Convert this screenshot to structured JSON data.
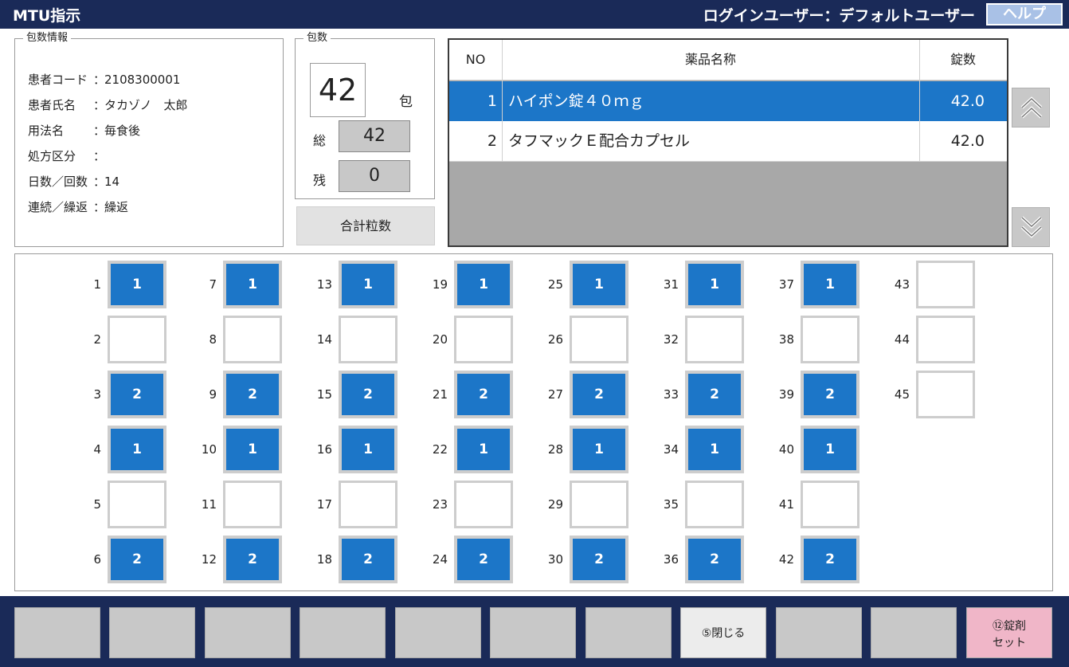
{
  "titlebar": {
    "title": "MTU指示",
    "login_user": "ログインユーザー：デフォルトユーザー",
    "help_label": "ヘルプ"
  },
  "package_info": {
    "legend": "包数情報",
    "rows": [
      {
        "label": "患者コード",
        "sep": "：",
        "value": "2108300001"
      },
      {
        "label": "患者氏名",
        "sep": "：",
        "value": "タカゾノ　太郎"
      },
      {
        "label": "用法名",
        "sep": "：",
        "value": "毎食後"
      },
      {
        "label": "処方区分",
        "sep": "：",
        "value": ""
      },
      {
        "label": "日数／回数",
        "sep": "：",
        "value": "14"
      },
      {
        "label": "連続／繰返",
        "sep": "：",
        "value": "繰返"
      }
    ]
  },
  "package_count": {
    "legend": "包数",
    "value": "42",
    "unit": "包",
    "total_label": "総",
    "total_value": "42",
    "remaining_label": "残",
    "remaining_value": "0"
  },
  "total_pills_button": "合計粒数",
  "drug_table": {
    "headers": {
      "no": "NO",
      "name": "薬品名称",
      "count": "錠数"
    },
    "rows": [
      {
        "no": "1",
        "name": "ハイポン錠４０ｍｇ",
        "count": "42.0",
        "selected": true
      },
      {
        "no": "2",
        "name": "タフマックＥ配合カプセル",
        "count": "42.0",
        "selected": false
      }
    ]
  },
  "scroll": {
    "up_icon": "double-chevron-up-icon",
    "down_icon": "double-chevron-down-icon"
  },
  "grid": {
    "cells": [
      {
        "n": "1",
        "v": "1"
      },
      {
        "n": "2",
        "v": ""
      },
      {
        "n": "3",
        "v": "2"
      },
      {
        "n": "4",
        "v": "1"
      },
      {
        "n": "5",
        "v": ""
      },
      {
        "n": "6",
        "v": "2"
      },
      {
        "n": "7",
        "v": "1"
      },
      {
        "n": "8",
        "v": ""
      },
      {
        "n": "9",
        "v": "2"
      },
      {
        "n": "10",
        "v": "1"
      },
      {
        "n": "11",
        "v": ""
      },
      {
        "n": "12",
        "v": "2"
      },
      {
        "n": "13",
        "v": "1"
      },
      {
        "n": "14",
        "v": ""
      },
      {
        "n": "15",
        "v": "2"
      },
      {
        "n": "16",
        "v": "1"
      },
      {
        "n": "17",
        "v": ""
      },
      {
        "n": "18",
        "v": "2"
      },
      {
        "n": "19",
        "v": "1"
      },
      {
        "n": "20",
        "v": ""
      },
      {
        "n": "21",
        "v": "2"
      },
      {
        "n": "22",
        "v": "1"
      },
      {
        "n": "23",
        "v": ""
      },
      {
        "n": "24",
        "v": "2"
      },
      {
        "n": "25",
        "v": "1"
      },
      {
        "n": "26",
        "v": ""
      },
      {
        "n": "27",
        "v": "2"
      },
      {
        "n": "28",
        "v": "1"
      },
      {
        "n": "29",
        "v": ""
      },
      {
        "n": "30",
        "v": "2"
      },
      {
        "n": "31",
        "v": "1"
      },
      {
        "n": "32",
        "v": ""
      },
      {
        "n": "33",
        "v": "2"
      },
      {
        "n": "34",
        "v": "1"
      },
      {
        "n": "35",
        "v": ""
      },
      {
        "n": "36",
        "v": "2"
      },
      {
        "n": "37",
        "v": "1"
      },
      {
        "n": "38",
        "v": ""
      },
      {
        "n": "39",
        "v": "2"
      },
      {
        "n": "40",
        "v": "1"
      },
      {
        "n": "41",
        "v": ""
      },
      {
        "n": "42",
        "v": "2"
      },
      {
        "n": "43",
        "v": ""
      },
      {
        "n": "44",
        "v": ""
      },
      {
        "n": "45",
        "v": ""
      }
    ]
  },
  "footer": {
    "close_label": "⑤閉じる",
    "set_label_line1": "⑫錠剤",
    "set_label_line2": "セット"
  },
  "colors": {
    "navy": "#1a2a58",
    "selection_blue": "#1c76c8",
    "help_button": "#a9c1e6",
    "set_button_pink": "#f0b6c8"
  }
}
